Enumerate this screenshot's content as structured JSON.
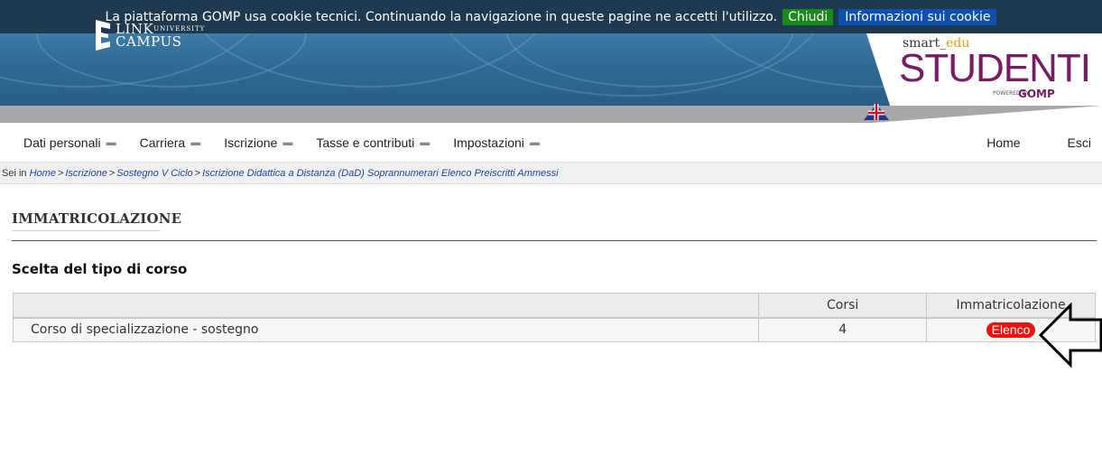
{
  "cookie_bar": {
    "message": "La piattaforma GOMP usa cookie tecnici. Continuando la navigazione in queste pagine ne accetti l'utilizzo.",
    "close_label": "Chiudi",
    "info_label": "Informazioni sui cookie"
  },
  "header": {
    "logo_text": "LINK",
    "logo_sub": "UNIVERSITY",
    "logo_text2": "CAMPUS",
    "brand_smart": "smart",
    "brand_edu": "edu",
    "brand_title": "STUDENTI",
    "brand_powered": "POWERED BY",
    "brand_gomp": "GOMP"
  },
  "nav": {
    "items": [
      {
        "label": "Dati personali"
      },
      {
        "label": "Carriera"
      },
      {
        "label": "Iscrizione"
      },
      {
        "label": "Tasse e contributi"
      },
      {
        "label": "Impostazioni"
      }
    ],
    "home_label": "Home",
    "logout_label": "Esci"
  },
  "breadcrumb": {
    "prefix": "Sei in",
    "items": [
      "Home",
      "Iscrizione",
      "Sostegno V Ciclo",
      "Iscrizione Didattica a Distanza (DaD) Soprannumerari Elenco Preiscritti Ammessi"
    ],
    "separator": ">"
  },
  "page": {
    "title": "IMMATRICOLAZIONE",
    "section_title": "Scelta del tipo di corso"
  },
  "table": {
    "headers": [
      "",
      "Corsi",
      "Immatricolazione"
    ],
    "rows": [
      {
        "name": "Corso di specializzazione - sostegno",
        "courses": "4",
        "action_label": "Elenco"
      }
    ]
  },
  "colors": {
    "cookie_bar_bg": "#1e3a50",
    "close_btn": "#1a8a1a",
    "info_btn": "#0f4fb0",
    "brand_purple": "#7a1a66",
    "elenco_btn": "#e8140c",
    "link_blue": "#1a3fb0"
  }
}
